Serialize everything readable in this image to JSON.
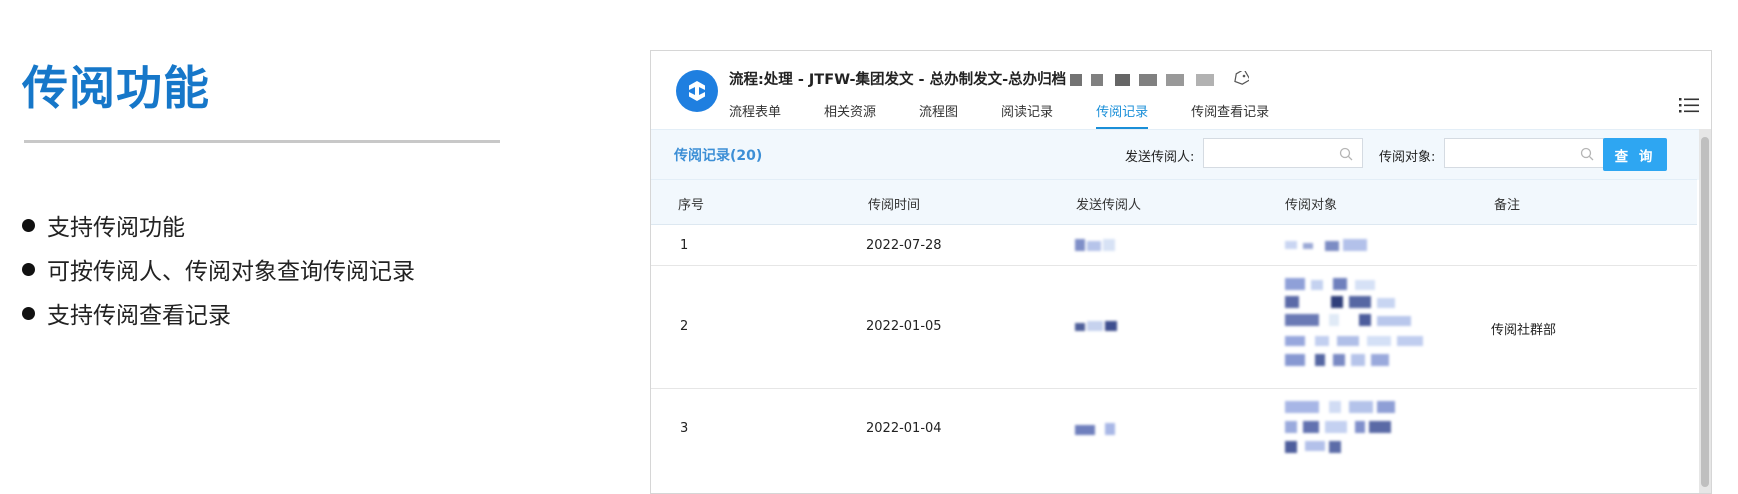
{
  "slide": {
    "title": "传阅功能",
    "bullets": [
      "支持传阅功能",
      "可按传阅人、传阅对象查询传阅记录",
      "支持传阅查看记录"
    ]
  },
  "app": {
    "process_title": "流程:处理 - JTFW-集团发文 - 总办制发文-总办归档",
    "tabs": [
      "流程表单",
      "相关资源",
      "流程图",
      "阅读记录",
      "传阅记录",
      "传阅查看记录"
    ],
    "active_tab": "传阅记录",
    "icons": {
      "logo": "app-logo-icon",
      "tag": "tag-icon",
      "menu": "list-menu-icon",
      "search": "search-icon"
    }
  },
  "toolbar": {
    "record_count": "传阅记录(20)",
    "sender_label": "发送传阅人:",
    "sender_value": "",
    "target_label": "传阅对象:",
    "target_value": "",
    "query_button": "查 询"
  },
  "table": {
    "columns": [
      "序号",
      "传阅时间",
      "发送传阅人",
      "传阅对象",
      "备注"
    ],
    "rows": [
      {
        "no": "1",
        "time": "2022-07-28",
        "remark": ""
      },
      {
        "no": "2",
        "time": "2022-01-05",
        "remark": "传阅社群部"
      },
      {
        "no": "3",
        "time": "2022-01-04",
        "remark": ""
      }
    ]
  },
  "colors": {
    "accent": "#1a8fd8",
    "title": "#1677c9",
    "button": "#2ea6f2",
    "header_bg": "#f2f8fd"
  }
}
